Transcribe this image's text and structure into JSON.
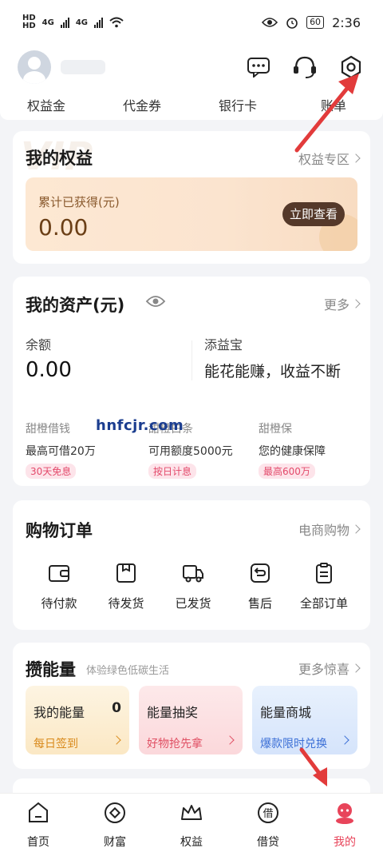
{
  "status_bar": {
    "left_badges": [
      "HD",
      "HD"
    ],
    "network_1": "4G",
    "network_2": "4G",
    "battery": "60",
    "time": "2:36"
  },
  "header": {
    "icons": [
      "message-icon",
      "customer-service-icon",
      "settings-icon"
    ]
  },
  "quick_tabs": [
    "权益金",
    "代金券",
    "银行卡",
    "账单"
  ],
  "benefits": {
    "title": "我的权益",
    "more": "权益专区",
    "label": "累计已获得(元)",
    "value": "0.00",
    "button": "立即查看"
  },
  "assets": {
    "title": "我的资产(元)",
    "more": "更多",
    "balance_label": "余额",
    "balance_value": "0.00",
    "tianyibao_label": "添益宝",
    "tianyibao_tagline": "能花能赚，收益不断",
    "products": [
      {
        "name": "甜橙借钱",
        "desc": "最高可借20万",
        "tag": "30天免息"
      },
      {
        "name": "甜橙白条",
        "desc": "可用额度5000元",
        "tag": "按日计息"
      },
      {
        "name": "甜橙保",
        "desc": "您的健康保障",
        "tag": "最高600万"
      }
    ]
  },
  "orders": {
    "title": "购物订单",
    "more": "电商购物",
    "items": [
      "待付款",
      "待发货",
      "已发货",
      "售后",
      "全部订单"
    ]
  },
  "energy": {
    "title": "攒能量",
    "subtitle": "体验绿色低碳生活",
    "more": "更多惊喜",
    "boxes": [
      {
        "title": "我的能量",
        "count": "0",
        "sub": "每日签到"
      },
      {
        "title": "能量抽奖",
        "count": "",
        "sub": "好物抢先拿"
      },
      {
        "title": "能量商城",
        "count": "",
        "sub": "爆款限时兑换"
      }
    ]
  },
  "bottom_nav": [
    "首页",
    "财富",
    "权益",
    "借贷",
    "我的"
  ],
  "watermark": "hnfcjr.com",
  "colors": {
    "accent_red": "#e8445a",
    "benefit_btn": "#55392a",
    "annotation": "#e23b3b"
  }
}
